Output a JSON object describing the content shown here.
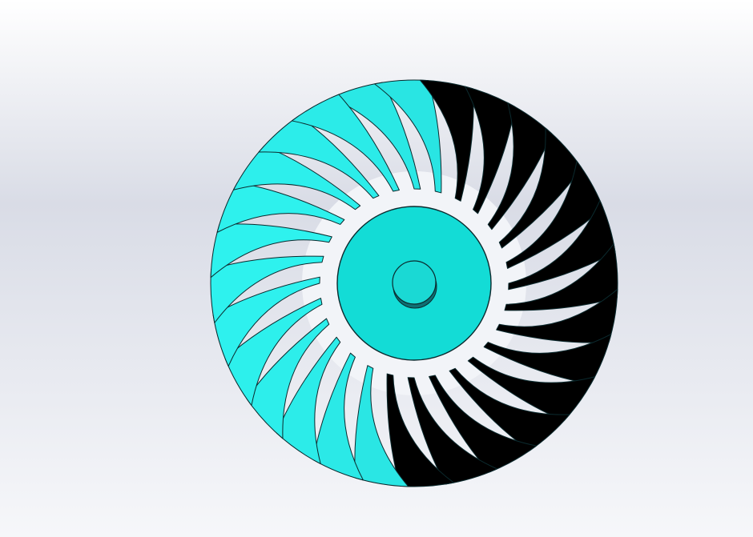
{
  "scene": {
    "background_colors": {
      "top": "#ffffff",
      "middle": "#d9dce6",
      "bottom": "#f6f7fa"
    },
    "object": "fan-rotor",
    "blade_count": 28,
    "colors": {
      "blade_light": "#2ef2ee",
      "blade_mid": "#1fc9cc",
      "blade_dark": "#0f6f73",
      "hub": "#13dcd6",
      "hub_boss": "#1ad9d4",
      "edge": "#0b2a2e",
      "gap": "#f2f4f8"
    }
  }
}
